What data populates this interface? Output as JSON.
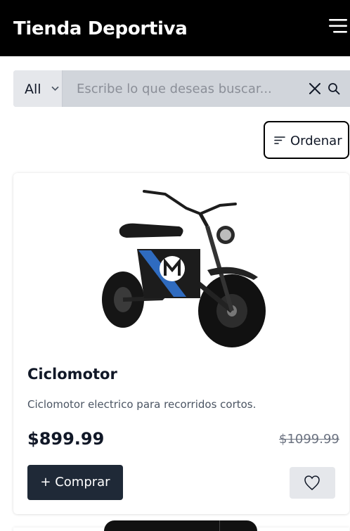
{
  "header": {
    "brand": "Tienda Deportiva",
    "menu_icon": "hamburger-menu-icon"
  },
  "search": {
    "category_value": "All",
    "placeholder": "Escribe lo que deseas buscar...",
    "value": "",
    "clear_icon": "close-icon",
    "search_icon": "search-icon"
  },
  "toolbar": {
    "sort_label": "Ordenar",
    "sort_icon": "sort-lines-icon"
  },
  "products": [
    {
      "name": "Ciclomotor",
      "description": "Ciclomotor electrico para recorridos cortos.",
      "price": "$899.99",
      "old_price": "$1099.99",
      "buy_label": "+ Comprar",
      "favorite_icon": "heart-outline-icon",
      "image": "electric-mini-bike-image"
    }
  ],
  "colors": {
    "header_bg": "#000000",
    "buy_button_bg": "#1f2937",
    "search_bg": "#d1d5db",
    "favorite_bg": "#e5e7eb"
  }
}
